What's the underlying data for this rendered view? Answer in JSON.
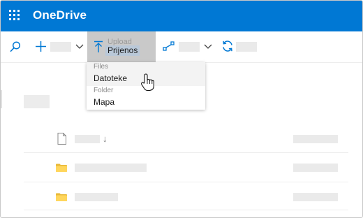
{
  "header": {
    "app_title": "OneDrive",
    "waffle_icon": "app-launcher-icon"
  },
  "command_bar": {
    "search_icon": "search-icon",
    "new_icon": "plus-icon",
    "upload_icon": "upload-icon",
    "upload_label": "Prijenos",
    "upload_ghost_label": "Upload",
    "flow_icon": "flow-icon",
    "sync_icon": "sync-icon",
    "chevron_icon": "chevron-down-icon"
  },
  "upload_menu": {
    "items": [
      {
        "label": "Datoteke",
        "ghost_label": "Files"
      },
      {
        "label": "Mapa",
        "ghost_label": "Folder"
      }
    ]
  },
  "file_list": {
    "header_icon": "file-icon",
    "sort_icon": "sort-arrow-icon",
    "sort_glyph": "↓",
    "rows": [
      {
        "icon": "folder-icon"
      },
      {
        "icon": "folder-icon"
      }
    ]
  },
  "colors": {
    "brand": "#0078d4",
    "folder": "#ffd65c",
    "hover_command": "#c9c9c9"
  }
}
